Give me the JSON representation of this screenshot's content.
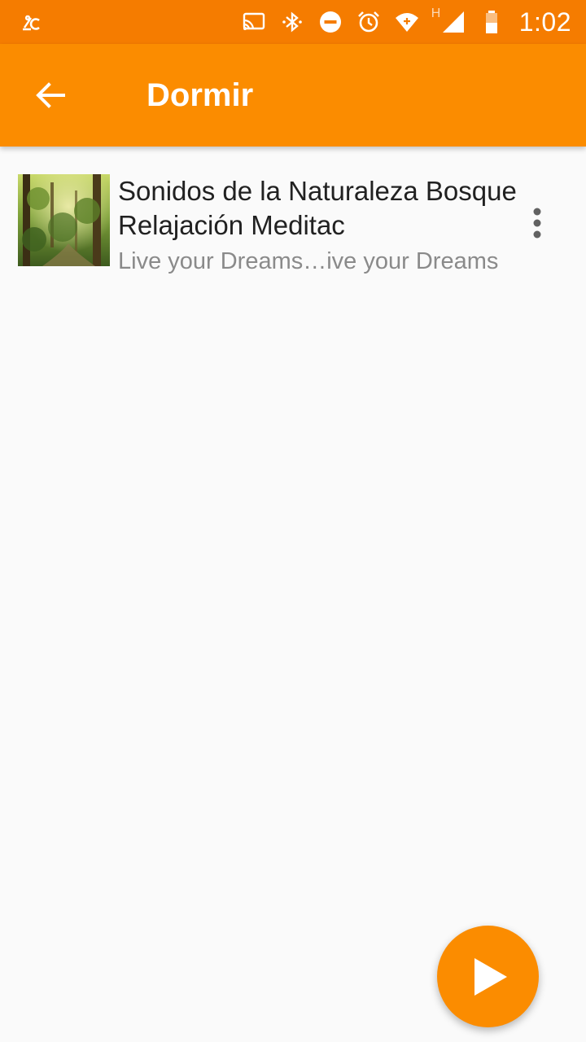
{
  "status_bar": {
    "time": "1:02",
    "icons": [
      "notification-icon",
      "cast-icon",
      "bluetooth-icon",
      "do-not-disturb-icon",
      "alarm-icon",
      "wifi-icon",
      "signal-icon",
      "battery-icon"
    ],
    "network_type": "H"
  },
  "app_bar": {
    "title": "Dormir",
    "back_icon": "arrow-back-icon"
  },
  "tracks": [
    {
      "title": "Sonidos de la Naturaleza Bosque Relajación Meditac",
      "subtitle": "Live your Dreams…ive your Dreams",
      "thumbnail": "forest-image",
      "menu_icon": "more-vert-icon"
    }
  ],
  "fab": {
    "icon": "play-icon"
  },
  "colors": {
    "status_bar": "#f57c00",
    "app_bar": "#fb8c00",
    "accent": "#fb8c00",
    "background": "#fafafa"
  }
}
